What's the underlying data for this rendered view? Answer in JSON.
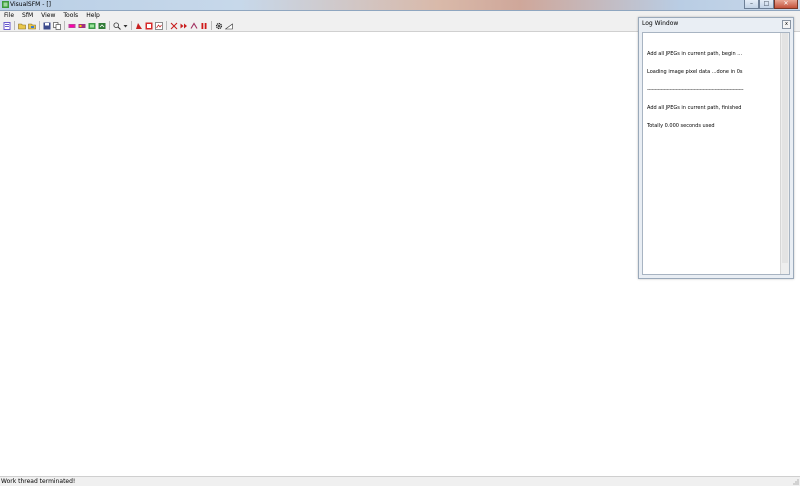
{
  "window": {
    "title": "VisualSFM - []",
    "controls": {
      "minimize": "–",
      "maximize": "□",
      "close": "✕"
    }
  },
  "menu": {
    "items": [
      "File",
      "SfM",
      "View",
      "Tools",
      "Help"
    ]
  },
  "toolbar": {
    "buttons": [
      "log-icon",
      "open-folder-icon",
      "open-multi-icon",
      "save-icon",
      "copy-icon",
      "match-icon",
      "pair-icon",
      "sift-icon",
      "reconstruct-icon",
      "zoom-icon",
      "dropdown-icon",
      "camera-icon",
      "dense-icon",
      "pmvs-icon",
      "fit-icon",
      "forward-icon",
      "merge-icon",
      "pause-icon",
      "gear-icon",
      "measure-icon"
    ]
  },
  "log_window": {
    "title": "Log Window",
    "close": "x",
    "lines": [
      "Add all JPEGs in current path, begin ...",
      "Loading image pixel data ...done in 0s",
      "----------------------------------------------------------------",
      "Add all JPEGs in current path, finished",
      "Totally 0.000 seconds used"
    ]
  },
  "status": {
    "text": "Work thread terminated!"
  },
  "colors": {
    "title_bar": "#c4d5e8",
    "chrome": "#f0f0f0",
    "canvas": "#ffffff",
    "log_frame": "#e9eef4"
  }
}
